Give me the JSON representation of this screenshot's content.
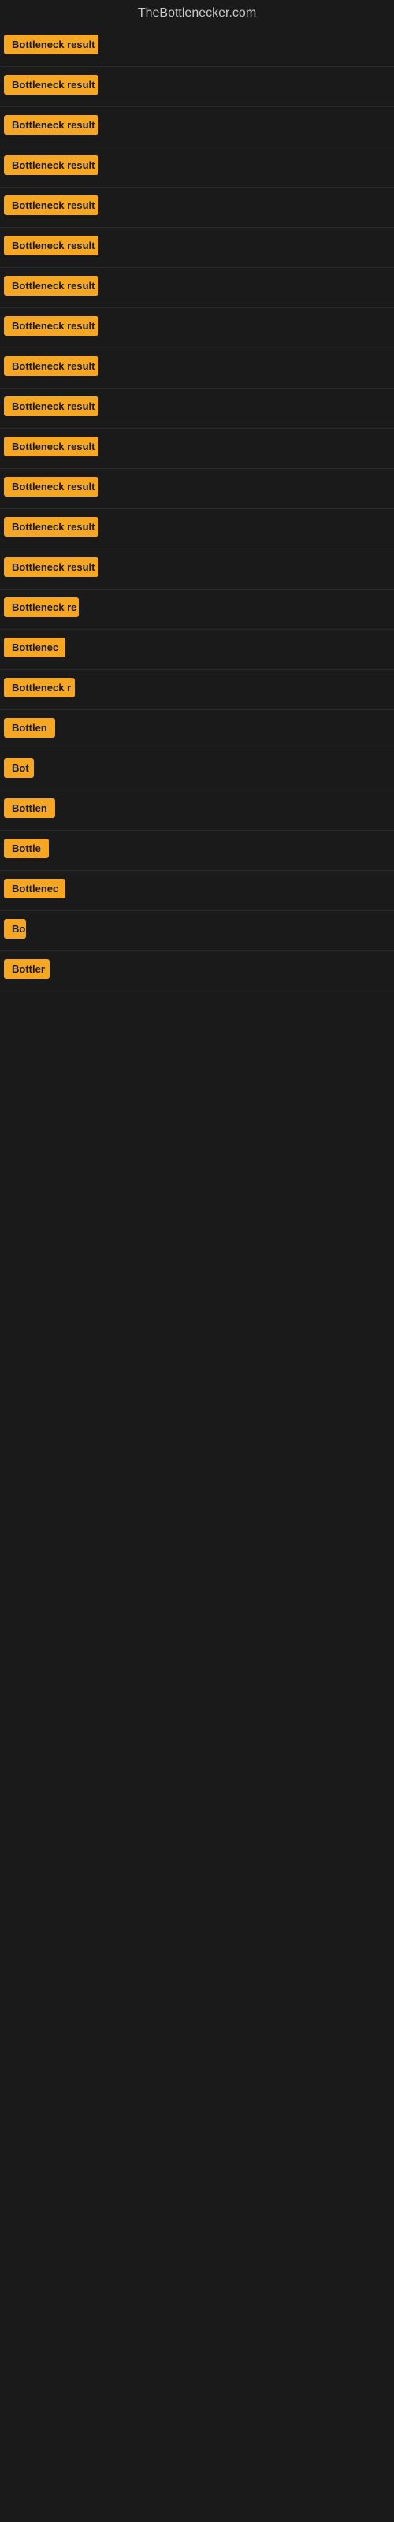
{
  "site": {
    "title": "TheBottlenecker.com"
  },
  "rows": [
    {
      "id": 1,
      "label": "Bottleneck result",
      "width": 120
    },
    {
      "id": 2,
      "label": "Bottleneck result",
      "width": 120
    },
    {
      "id": 3,
      "label": "Bottleneck result",
      "width": 120
    },
    {
      "id": 4,
      "label": "Bottleneck result",
      "width": 120
    },
    {
      "id": 5,
      "label": "Bottleneck result",
      "width": 120
    },
    {
      "id": 6,
      "label": "Bottleneck result",
      "width": 120
    },
    {
      "id": 7,
      "label": "Bottleneck result",
      "width": 120
    },
    {
      "id": 8,
      "label": "Bottleneck result",
      "width": 120
    },
    {
      "id": 9,
      "label": "Bottleneck result",
      "width": 120
    },
    {
      "id": 10,
      "label": "Bottleneck result",
      "width": 120
    },
    {
      "id": 11,
      "label": "Bottleneck result",
      "width": 120
    },
    {
      "id": 12,
      "label": "Bottleneck result",
      "width": 120
    },
    {
      "id": 13,
      "label": "Bottleneck result",
      "width": 120
    },
    {
      "id": 14,
      "label": "Bottleneck result",
      "width": 120
    },
    {
      "id": 15,
      "label": "Bottleneck re",
      "width": 95
    },
    {
      "id": 16,
      "label": "Bottlenec",
      "width": 78
    },
    {
      "id": 17,
      "label": "Bottleneck r",
      "width": 90
    },
    {
      "id": 18,
      "label": "Bottlen",
      "width": 68
    },
    {
      "id": 19,
      "label": "Bot",
      "width": 38
    },
    {
      "id": 20,
      "label": "Bottlen",
      "width": 68
    },
    {
      "id": 21,
      "label": "Bottle",
      "width": 58
    },
    {
      "id": 22,
      "label": "Bottlenec",
      "width": 78
    },
    {
      "id": 23,
      "label": "Bo",
      "width": 28
    },
    {
      "id": 24,
      "label": "Bottler",
      "width": 58
    }
  ],
  "colors": {
    "badge_bg": "#f5a623",
    "badge_text": "#1a1a1a",
    "site_title": "#cccccc",
    "background": "#1a1a1a"
  }
}
